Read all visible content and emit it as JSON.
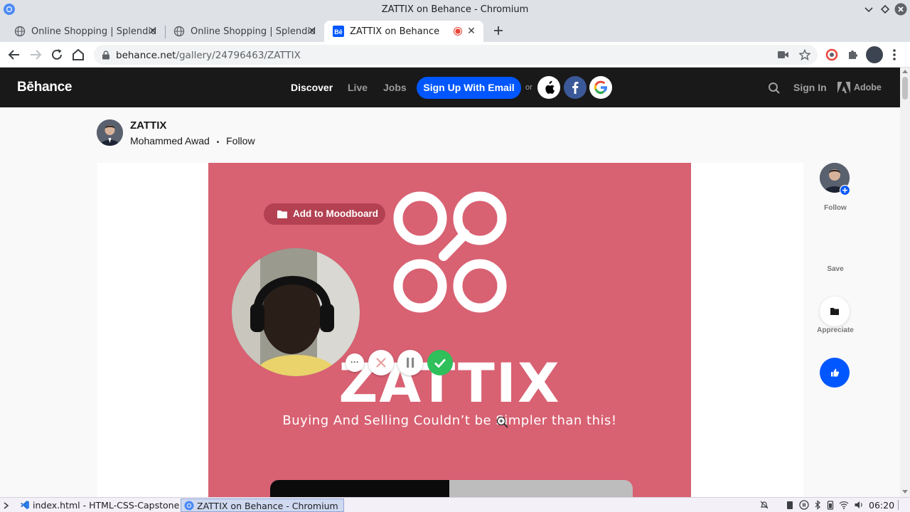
{
  "window": {
    "title": "ZATTIX on Behance - Chromium"
  },
  "tabs": [
    {
      "label": "Online Shopping | Splendid",
      "active": false
    },
    {
      "label": "Online Shopping | Splendid",
      "active": false
    },
    {
      "label": "ZATTIX on Behance",
      "active": true
    }
  ],
  "address_bar": {
    "host": "behance.net",
    "path": "/gallery/24796463/ZATTIX"
  },
  "behance_nav": {
    "logo": "Bēhance",
    "links": [
      "Discover",
      "Live",
      "Jobs"
    ],
    "signup_label": "Sign Up With Email",
    "or_label": "or",
    "signin_label": "Sign In",
    "adobe_label": "Adobe"
  },
  "project": {
    "title": "ZATTIX",
    "owner": "Mohammed Awad",
    "separator": "•",
    "follow_label": "Follow"
  },
  "artwork": {
    "moodboard_label": "Add to Moodboard",
    "headline": "ZATTIX",
    "tagline": "Buying And Selling Couldn’t be Simpler than this!",
    "background_color": "#d86172"
  },
  "recorder": {
    "more_label": "···"
  },
  "side_actions": {
    "follow_label": "Follow",
    "save_label": "Save",
    "appreciate_label": "Appreciate",
    "appreciate_color": "#0057ff"
  },
  "taskbar": {
    "items": [
      "index.html - HTML-CSS-Capstone -...",
      "ZATTIX on Behance - Chromium"
    ],
    "clock": "06:20"
  }
}
